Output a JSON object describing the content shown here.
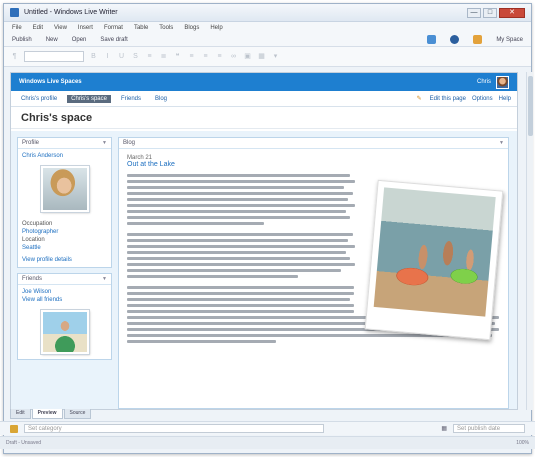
{
  "window": {
    "title": "Untitled - Windows Live Writer",
    "controls": [
      "—",
      "□",
      "✕"
    ]
  },
  "menu": [
    "File",
    "Edit",
    "View",
    "Insert",
    "Format",
    "Table",
    "Tools",
    "Blogs",
    "Help"
  ],
  "toolbar1": {
    "publish": "Publish",
    "new": "New",
    "open": "Open",
    "save_draft": "Save draft",
    "blog_name": "My Space"
  },
  "site": {
    "logo": "Windows Live Spaces",
    "user": "Chris"
  },
  "space_nav": {
    "tabs": [
      "Chris's profile",
      "Chris's space",
      "Friends",
      "Blog"
    ],
    "active_tab": 1,
    "actions": [
      "Edit this page",
      "Options",
      "Help"
    ]
  },
  "space": {
    "title": "Chris's space"
  },
  "profile": {
    "header": "Profile",
    "name_link": "Chris Anderson",
    "occupation_label": "Occupation",
    "occupation_value": "Photographer",
    "location_label": "Location",
    "location_value": "Seattle",
    "more_link": "View profile details"
  },
  "friends": {
    "header": "Friends",
    "friend_link": "Joe Wilson",
    "more_link": "View all friends"
  },
  "blog": {
    "header": "Blog",
    "date": "March 21",
    "post_title": "Out at the Lake"
  },
  "bottom_tabs": [
    "Edit",
    "Preview",
    "Source"
  ],
  "bottom_active": 1,
  "status": {
    "category_placeholder": "Set category",
    "date_placeholder": "Set publish date",
    "left_text": "Draft - Unsaved",
    "right_text": "100%"
  },
  "colors": {
    "site_bar": "#1e7fd0",
    "link": "#1d6fc0",
    "panel_bg": "#e9f3fb"
  }
}
